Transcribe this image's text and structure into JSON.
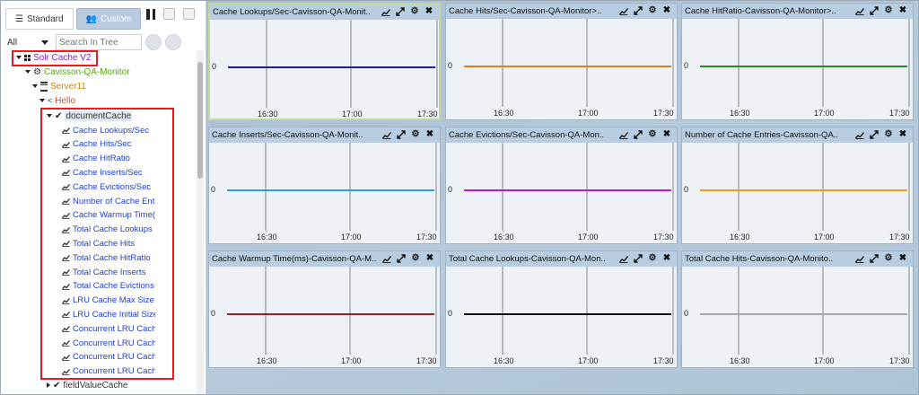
{
  "left": {
    "tabs": [
      {
        "label": "Standard",
        "icon": "list-icon"
      },
      {
        "label": "Custom",
        "icon": "user-group-icon"
      }
    ],
    "filter_select": "All",
    "search_placeholder": "Search In Tree",
    "tree": {
      "root": {
        "label": "Solr Cache V2",
        "color": "#8a1fbf"
      },
      "monitor": {
        "label": "Cavisson-QA-Monitor",
        "color": "#5aa51a"
      },
      "server": {
        "label": "Server11",
        "color": "#d98200"
      },
      "hello": {
        "label": "Hello",
        "color": "#e05020"
      },
      "group": {
        "label": "documentCache"
      },
      "leaves": [
        "Cache Lookups/Sec",
        "Cache Hits/Sec",
        "Cache HitRatio",
        "Cache Inserts/Sec",
        "Cache Evictions/Sec",
        "Number of Cache Entries",
        "Cache Warmup Time(ms)",
        "Total Cache Lookups",
        "Total Cache Hits",
        "Total Cache HitRatio",
        "Total Cache Inserts",
        "Total Cache Evictions",
        "LRU Cache Max Size",
        "LRU Cache Initial Size",
        "Concurrent LRU Cache Max Size",
        "Concurrent LRU Cache Initial Size",
        "Concurrent LRU Cache Min Size",
        "Concurrent LRU Cache Acceptable Size"
      ],
      "next_group": {
        "label": "fieldValueCache"
      }
    }
  },
  "panels": [
    {
      "title": "Cache Lookups/Sec-Cavisson-QA-Monit..",
      "color": "#1a1aa6",
      "selected": true
    },
    {
      "title": "Cache Hits/Sec-Cavisson-QA-Monitor>..",
      "color": "#ef7a1a"
    },
    {
      "title": "Cache HitRatio-Cavisson-QA-Monitor>..",
      "color": "#1f8a2a"
    },
    {
      "title": "Cache Inserts/Sec-Cavisson-QA-Monit..",
      "color": "#2a9fd6"
    },
    {
      "title": "Cache Evictions/Sec-Cavisson-QA-Mon..",
      "color": "#c01ac0"
    },
    {
      "title": "Number of Cache Entries-Cavisson-QA..",
      "color": "#e6a11a"
    },
    {
      "title": "Cache Warmup Time(ms)-Cavisson-QA-M..",
      "color": "#a0201a"
    },
    {
      "title": "Total Cache Lookups-Cavisson-QA-Mon..",
      "color": "#111111"
    },
    {
      "title": "Total Cache Hits-Cavisson-QA-Monito..",
      "color": "#a8a8a8"
    }
  ],
  "chart_defaults": {
    "y_label": "0",
    "x_ticks": [
      "16:30",
      "17:00",
      "17:30"
    ],
    "series_value": 0
  },
  "chart_data": [
    {
      "type": "line",
      "title": "Cache Lookups/Sec-Cavisson-QA-Monit..",
      "x": [
        "16:30",
        "17:00",
        "17:30"
      ],
      "values": [
        0,
        0,
        0
      ],
      "ylim": [
        0,
        0
      ]
    },
    {
      "type": "line",
      "title": "Cache Hits/Sec-Cavisson-QA-Monitor>..",
      "x": [
        "16:30",
        "17:00",
        "17:30"
      ],
      "values": [
        0,
        0,
        0
      ],
      "ylim": [
        0,
        0
      ]
    },
    {
      "type": "line",
      "title": "Cache HitRatio-Cavisson-QA-Monitor>..",
      "x": [
        "16:30",
        "17:00",
        "17:30"
      ],
      "values": [
        0,
        0,
        0
      ],
      "ylim": [
        0,
        0
      ]
    },
    {
      "type": "line",
      "title": "Cache Inserts/Sec-Cavisson-QA-Monit..",
      "x": [
        "16:30",
        "17:00",
        "17:30"
      ],
      "values": [
        0,
        0,
        0
      ],
      "ylim": [
        0,
        0
      ]
    },
    {
      "type": "line",
      "title": "Cache Evictions/Sec-Cavisson-QA-Mon..",
      "x": [
        "16:30",
        "17:00",
        "17:30"
      ],
      "values": [
        0,
        0,
        0
      ],
      "ylim": [
        0,
        0
      ]
    },
    {
      "type": "line",
      "title": "Number of Cache Entries-Cavisson-QA..",
      "x": [
        "16:30",
        "17:00",
        "17:30"
      ],
      "values": [
        0,
        0,
        0
      ],
      "ylim": [
        0,
        0
      ]
    },
    {
      "type": "line",
      "title": "Cache Warmup Time(ms)-Cavisson-QA-M..",
      "x": [
        "16:30",
        "17:00",
        "17:30"
      ],
      "values": [
        0,
        0,
        0
      ],
      "ylim": [
        0,
        0
      ]
    },
    {
      "type": "line",
      "title": "Total Cache Lookups-Cavisson-QA-Mon..",
      "x": [
        "16:30",
        "17:00",
        "17:30"
      ],
      "values": [
        0,
        0,
        0
      ],
      "ylim": [
        0,
        0
      ]
    },
    {
      "type": "line",
      "title": "Total Cache Hits-Cavisson-QA-Monito..",
      "x": [
        "16:30",
        "17:00",
        "17:30"
      ],
      "values": [
        0,
        0,
        0
      ],
      "ylim": [
        0,
        0
      ]
    }
  ]
}
